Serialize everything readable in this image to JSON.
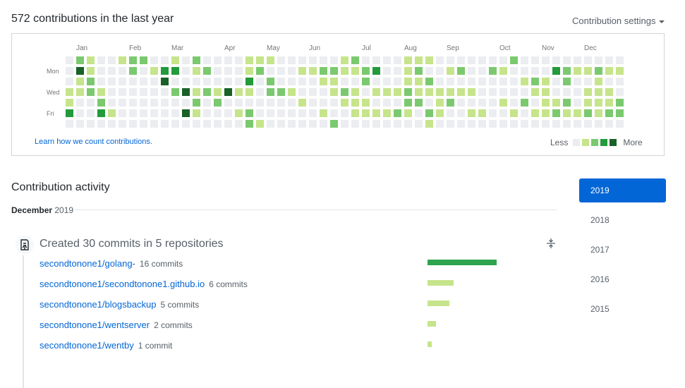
{
  "summary": {
    "title": "572 contributions in the last year",
    "settings_label": "Contribution settings"
  },
  "calendar": {
    "months": [
      "Jan",
      "Feb",
      "Mar",
      "Apr",
      "May",
      "Jun",
      "Jul",
      "Aug",
      "Sep",
      "Oct",
      "Nov",
      "Dec"
    ],
    "month_week_index": [
      1,
      6,
      10,
      15,
      19,
      23,
      28,
      32,
      36,
      41,
      45,
      49
    ],
    "weekday_labels": [
      {
        "label": "Mon",
        "row": 1
      },
      {
        "label": "Wed",
        "row": 3
      },
      {
        "label": "Fri",
        "row": 5
      }
    ],
    "colors": [
      "#ebedf0",
      "#c6e48b",
      "#7bc96f",
      "#239a3b",
      "#196127"
    ],
    "levels": [
      [
        0,
        2,
        1,
        0,
        0,
        1,
        2,
        2,
        0,
        0,
        1,
        0,
        2,
        0,
        0,
        0,
        0,
        1,
        1,
        1,
        0,
        0,
        0,
        0,
        0,
        0,
        1,
        2,
        0,
        0,
        0,
        0,
        1,
        1,
        1,
        0,
        0,
        0,
        0,
        0,
        0,
        0,
        2,
        0,
        0,
        0,
        0,
        0,
        0,
        0,
        0,
        0,
        0
      ],
      [
        0,
        4,
        1,
        0,
        0,
        0,
        2,
        0,
        1,
        3,
        3,
        0,
        1,
        2,
        0,
        0,
        0,
        1,
        2,
        0,
        0,
        0,
        1,
        1,
        2,
        2,
        1,
        1,
        2,
        3,
        0,
        0,
        1,
        2,
        0,
        0,
        1,
        2,
        0,
        0,
        2,
        1,
        0,
        0,
        0,
        0,
        3,
        2,
        1,
        1,
        2,
        1,
        1
      ],
      [
        0,
        1,
        2,
        0,
        0,
        0,
        0,
        0,
        0,
        4,
        0,
        0,
        0,
        0,
        0,
        0,
        0,
        3,
        0,
        2,
        0,
        0,
        0,
        0,
        1,
        1,
        0,
        0,
        2,
        0,
        0,
        0,
        1,
        1,
        2,
        0,
        0,
        0,
        0,
        0,
        0,
        0,
        0,
        1,
        2,
        1,
        0,
        2,
        0,
        0,
        1,
        0,
        0
      ],
      [
        1,
        1,
        2,
        1,
        0,
        0,
        0,
        0,
        0,
        0,
        2,
        4,
        1,
        2,
        1,
        4,
        1,
        1,
        0,
        2,
        2,
        1,
        0,
        0,
        0,
        1,
        2,
        1,
        0,
        1,
        1,
        1,
        2,
        1,
        1,
        1,
        1,
        1,
        1,
        0,
        0,
        0,
        0,
        0,
        1,
        1,
        0,
        0,
        0,
        1,
        1,
        1,
        0
      ],
      [
        1,
        0,
        0,
        2,
        0,
        0,
        0,
        0,
        0,
        0,
        0,
        0,
        2,
        0,
        2,
        0,
        0,
        0,
        0,
        0,
        0,
        0,
        1,
        0,
        0,
        0,
        1,
        1,
        1,
        0,
        0,
        0,
        2,
        2,
        0,
        1,
        2,
        0,
        0,
        0,
        0,
        1,
        0,
        2,
        0,
        1,
        1,
        2,
        0,
        1,
        1,
        1,
        2
      ],
      [
        3,
        0,
        0,
        3,
        1,
        0,
        0,
        0,
        0,
        0,
        0,
        4,
        1,
        0,
        0,
        0,
        1,
        2,
        0,
        0,
        0,
        0,
        0,
        0,
        1,
        0,
        0,
        1,
        1,
        1,
        1,
        2,
        1,
        0,
        2,
        1,
        0,
        0,
        1,
        1,
        0,
        0,
        1,
        0,
        1,
        1,
        2,
        1,
        1,
        2,
        1,
        2,
        2
      ],
      [
        0,
        0,
        0,
        0,
        0,
        0,
        0,
        0,
        0,
        0,
        0,
        0,
        0,
        0,
        0,
        0,
        0,
        2,
        1,
        0,
        0,
        0,
        0,
        0,
        0,
        2,
        0,
        0,
        0,
        0,
        0,
        0,
        0,
        0,
        1,
        0,
        0,
        0,
        0,
        0,
        0,
        0,
        0,
        0,
        0,
        0,
        0,
        0,
        0,
        0,
        0,
        0,
        0
      ]
    ],
    "learn_label": "Learn how we count contributions.",
    "legend_less": "Less",
    "legend_more": "More"
  },
  "activity": {
    "title": "Contribution activity",
    "month": "December",
    "year": "2019",
    "commits_heading": "Created 30 commits in 5 repositories",
    "max_commits": 16,
    "repos": [
      {
        "name": "secondtonone1/golang-",
        "count_label": "16 commits",
        "commits": 16,
        "color": "#2ea44f"
      },
      {
        "name": "secondtonone1/secondtonone1.github.io",
        "count_label": "6 commits",
        "commits": 6,
        "color": "#c6e48b"
      },
      {
        "name": "secondtonone1/blogsbackup",
        "count_label": "5 commits",
        "commits": 5,
        "color": "#c6e48b"
      },
      {
        "name": "secondtonone1/wentserver",
        "count_label": "2 commits",
        "commits": 2,
        "color": "#c6e48b"
      },
      {
        "name": "secondtonone1/wentby",
        "count_label": "1 commit",
        "commits": 1,
        "color": "#c6e48b"
      }
    ]
  },
  "years": [
    {
      "label": "2019",
      "selected": true
    },
    {
      "label": "2018",
      "selected": false
    },
    {
      "label": "2017",
      "selected": false
    },
    {
      "label": "2016",
      "selected": false
    },
    {
      "label": "2015",
      "selected": false
    }
  ],
  "accent": "#0366d6"
}
